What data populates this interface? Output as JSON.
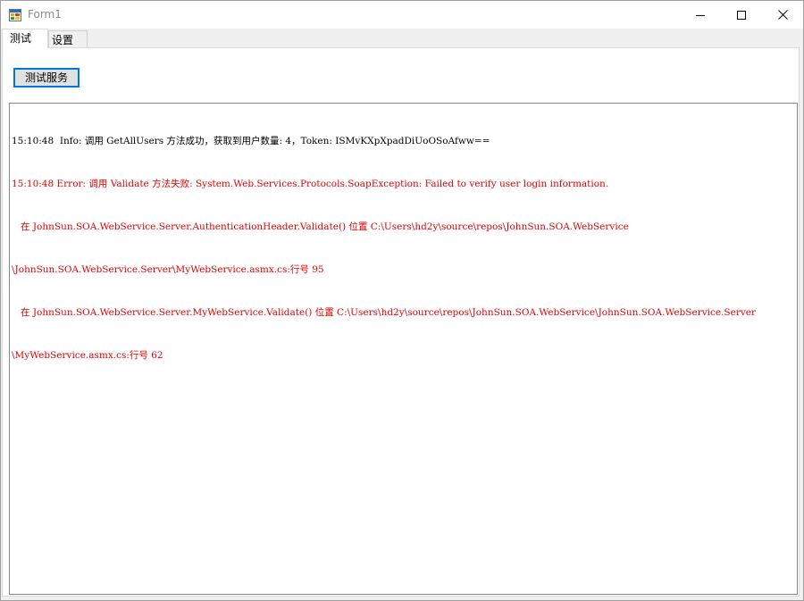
{
  "window": {
    "title": "Form1"
  },
  "colors": {
    "error_text": "#e00000",
    "info_text": "#000000",
    "focus_border": "#0078d7"
  },
  "icons": {
    "app": "winforms-app-icon",
    "minimize": "minimize-icon",
    "maximize": "maximize-icon",
    "close": "close-icon"
  },
  "tabs": [
    {
      "label": "测试",
      "selected": true
    },
    {
      "label": "设置",
      "selected": false
    }
  ],
  "test_tab": {
    "button_label": "测试服务"
  },
  "log": {
    "lines": [
      {
        "level": "info",
        "text": "15:10:48  Info: 调用 GetAllUsers 方法成功，获取到用户数量: 4，Token: ISMvKXpXpadDiUoOSoAfww=="
      },
      {
        "level": "error",
        "text": "15:10:48 Error: 调用 Validate 方法失败: System.Web.Services.Protocols.SoapException: Failed to verify user login information."
      },
      {
        "level": "error",
        "text": "   在 JohnSun.SOA.WebService.Server.AuthenticationHeader.Validate() 位置 C:\\Users\\hd2y\\source\\repos\\JohnSun.SOA.WebService"
      },
      {
        "level": "error",
        "text": "\\JohnSun.SOA.WebService.Server\\MyWebService.asmx.cs:行号 95"
      },
      {
        "level": "error",
        "text": "   在 JohnSun.SOA.WebService.Server.MyWebService.Validate() 位置 C:\\Users\\hd2y\\source\\repos\\JohnSun.SOA.WebService\\JohnSun.SOA.WebService.Server"
      },
      {
        "level": "error",
        "text": "\\MyWebService.asmx.cs:行号 62"
      }
    ]
  }
}
